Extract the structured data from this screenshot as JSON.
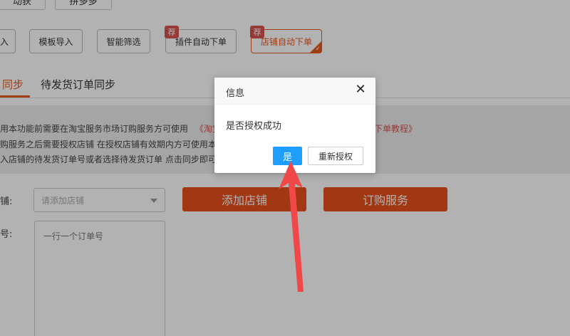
{
  "top_buttons": [
    {
      "label": "动获"
    },
    {
      "label": "拼多多"
    }
  ],
  "toolbar": [
    {
      "label": "入"
    },
    {
      "label": "模板导入"
    },
    {
      "label": "智能筛选"
    },
    {
      "label": "插件自动下单",
      "badge": "荐"
    },
    {
      "label": "店铺自动下单",
      "badge": "荐",
      "active": true
    }
  ],
  "tabs": [
    {
      "label": "同步",
      "active": true
    },
    {
      "label": "待发货订单同步"
    }
  ],
  "info": {
    "line1_prefix": "用本功能前需要在淘宝服务市场订购服务方可使用",
    "line1_link": "《淘宝",
    "line1_link_end": "下单教程》",
    "line2": "购服务之后需要授权店铺 在授权店铺有效期内方可使用本",
    "line3": "入店铺的待发货订单号或者选择待发货订单 点击同步即可"
  },
  "form": {
    "shop_label": "铺:",
    "shop_placeholder": "请添加店铺",
    "add_shop_label": "添加店铺",
    "subscribe_label": "订购服务",
    "order_label": "号:",
    "order_placeholder": "一行一个订单号"
  },
  "dialog": {
    "title": "信息",
    "close_glyph": "✕",
    "message": "是否授权成功",
    "yes_label": "是",
    "reauth_label": "重新授权"
  },
  "colors": {
    "accent": "#e8501c",
    "primary": "#1e9fff",
    "badge": "#d9534f",
    "arrow": "#f04848"
  }
}
